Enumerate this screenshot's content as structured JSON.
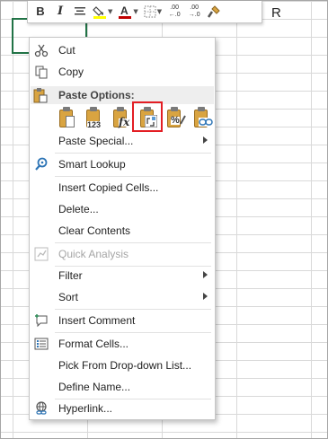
{
  "mini_toolbar": {
    "bold": "B",
    "italic": "I",
    "decrease_decimal_1": ".00",
    "decrease_decimal_2": "←.0",
    "increase_decimal_1": ".00",
    "increase_decimal_2": "→.0"
  },
  "column_letter": "R",
  "context_menu": {
    "cut": "Cut",
    "copy": "Copy",
    "paste_options": "Paste Options:",
    "paste_icons": [
      "paste-icon",
      "paste-values-icon",
      "paste-formulas-icon",
      "paste-transpose-icon",
      "paste-formatting-icon",
      "paste-link-icon"
    ],
    "paste_icon_texts": [
      "123",
      "fx",
      "%"
    ],
    "paste_special": "Paste Special...",
    "smart_lookup": "Smart Lookup",
    "insert_copied_cells": "Insert Copied Cells...",
    "delete": "Delete...",
    "clear_contents": "Clear Contents",
    "quick_analysis": "Quick Analysis",
    "filter": "Filter",
    "sort": "Sort",
    "insert_comment": "Insert Comment",
    "format_cells": "Format Cells...",
    "pick_from_dropdown": "Pick From Drop-down List...",
    "define_name": "Define Name...",
    "hyperlink": "Hyperlink..."
  },
  "colors": {
    "highlight_border": "#e31e24",
    "active_cell": "#217346",
    "font_color_bar": "#c00000",
    "fill_color_bar": "#ffff00"
  }
}
